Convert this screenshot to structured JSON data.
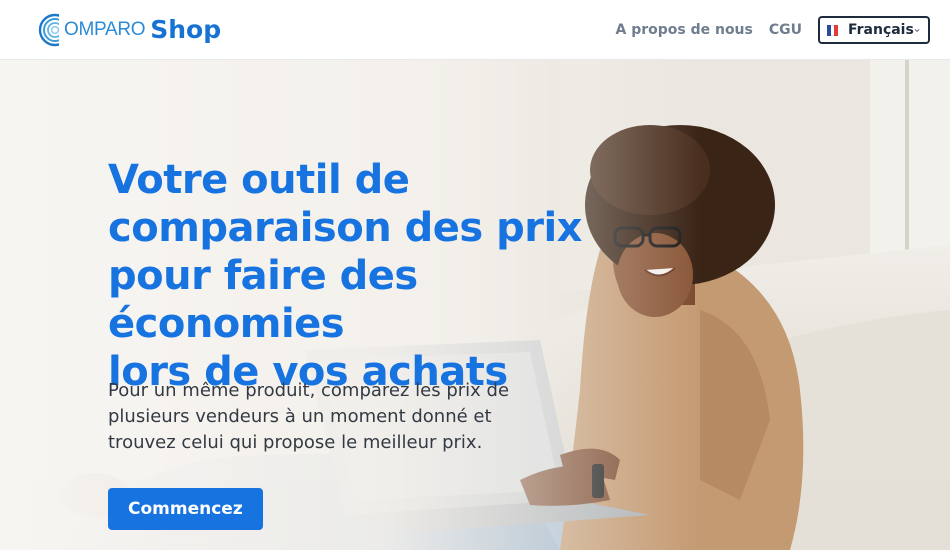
{
  "header": {
    "logo": {
      "text": "OMPARO",
      "shop": "Shop"
    },
    "nav": [
      {
        "label": "A propos de nous"
      },
      {
        "label": "CGU"
      }
    ],
    "language": {
      "selected": "Français",
      "flag_colors": [
        "#2a4d9b",
        "#ffffff",
        "#e23b3b"
      ]
    }
  },
  "hero": {
    "title_lines": [
      "Votre outil de",
      "comparaison des prix",
      "pour faire des économies",
      "lors de vos achats"
    ],
    "description": "Pour un même produit, comparez les prix de plusieurs vendeurs à un moment donné et trouvez celui qui propose le meilleur prix.",
    "cta_label": "Commencez"
  },
  "colors": {
    "brand_blue": "#1673e0",
    "logo_blue": "#2c8bd6",
    "nav_text": "#6f7d8e",
    "select_border": "#1e2b3c",
    "body_text": "#333a44"
  }
}
